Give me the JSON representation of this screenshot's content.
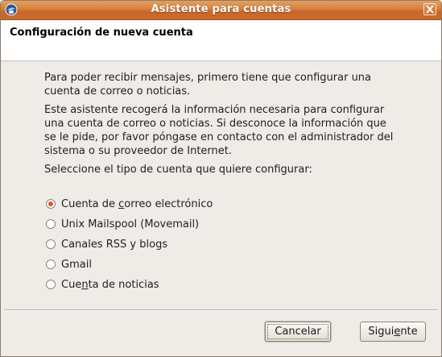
{
  "window": {
    "title": "Asistente para cuentas",
    "icon": "thunderbird-icon",
    "close_icon": "close-icon"
  },
  "header": {
    "title": "Configuración de nueva cuenta"
  },
  "content": {
    "intro": "Para poder recibir mensajes, primero tiene que configurar una cuenta de correo o noticias.",
    "info": "Este asistente recogerá la información necesaria para configurar una cuenta de correo o noticias. Si desconoce la información que se le pide, por favor póngase en contacto con el administrador del sistema o su proveedor de Internet.",
    "prompt": "Seleccione el tipo de cuenta que quiere configurar:"
  },
  "account_types": [
    {
      "label_before": "Cuenta de ",
      "mnemonic": "c",
      "label_after": "orreo electrónico",
      "selected": true
    },
    {
      "label_before": "Unix Mailspool (Movemail)",
      "mnemonic": "",
      "label_after": "",
      "selected": false
    },
    {
      "label_before": "Canales RSS y blogs",
      "mnemonic": "",
      "label_after": "",
      "selected": false
    },
    {
      "label_before": "Gmail",
      "mnemonic": "",
      "label_after": "",
      "selected": false
    },
    {
      "label_before": "Cue",
      "mnemonic": "n",
      "label_after": "ta de noticias",
      "selected": false
    }
  ],
  "buttons": {
    "cancel": "Cancelar",
    "next_before": "Sigui",
    "next_mnemonic": "e",
    "next_after": "nte"
  },
  "colors": {
    "titlebar": "#d6803c",
    "radio_selected": "#d45b20",
    "window_bg": "#efebe7"
  }
}
